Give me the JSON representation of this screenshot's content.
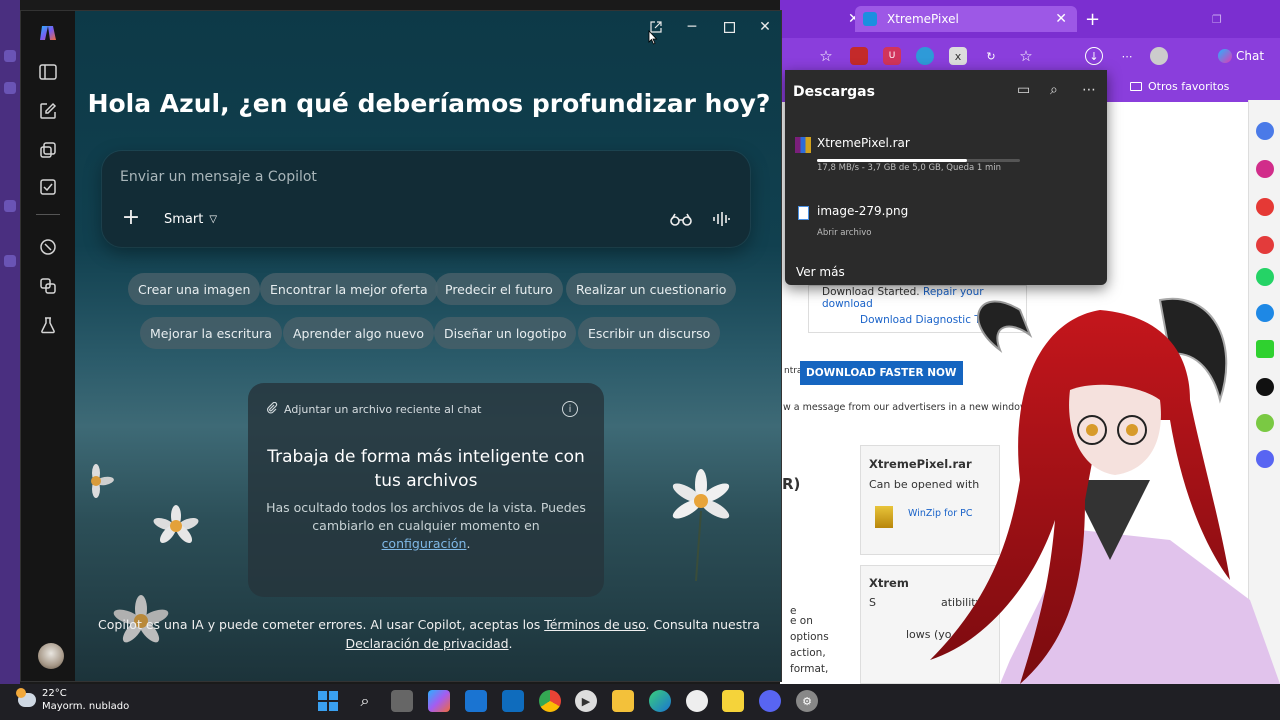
{
  "copilot": {
    "greeting": "Hola Azul, ¿en qué deberíamos profundizar hoy?",
    "composer": {
      "placeholder": "Enviar un mensaje a Copilot",
      "mode_label": "Smart"
    },
    "chips_row1": [
      "Crear una imagen",
      "Encontrar la mejor oferta",
      "Predecir el futuro",
      "Realizar un cuestionario"
    ],
    "chips_row2": [
      "Mejorar la escritura",
      "Aprender algo nuevo",
      "Diseñar un logotipo",
      "Escribir un discurso"
    ],
    "file_card": {
      "header": "Adjuntar un archivo reciente al chat",
      "title": "Trabaja de forma más inteligente con tus archivos",
      "body": "Has ocultado todos los archivos de la vista. Puedes cambiarlo en cualquier momento en",
      "link": "configuración",
      "period": "."
    },
    "disclaimer": {
      "part1": "Copilot es una IA y puede cometer errores. Al usar Copilot, aceptas los",
      "terms_link": "Términos de uso",
      "part2": ". Consulta nuestra",
      "privacy_link": "Declaración de privacidad",
      "part3": "."
    }
  },
  "browser": {
    "tab_active": "XtremePixel",
    "chat_label": "Chat",
    "bookmarks_label": "Otros favoritos"
  },
  "downloads": {
    "title": "Descargas",
    "items": [
      {
        "name": "XtremePixel.rar",
        "meta": "17,8 MB/s - 3,7 GB de 5,0 GB, Queda 1 min",
        "progress": 0.74
      },
      {
        "name": "image-279.png",
        "meta": "Abrir archivo"
      }
    ],
    "more": "Ver más"
  },
  "webpage": {
    "download_started": "Download Started.",
    "repair_link": "Repair your download",
    "diagnostic_link": "Download Diagnostic Tool",
    "faster_button": "DOWNLOAD FASTER NOW",
    "ntra_text": "ntra",
    "advert_text": "w a message from our advertisers in a new window",
    "r_text": "R)",
    "card1_title": "XtremePixel.rar",
    "card1_open": "Can be opened with",
    "card1_winzip": "WinZip for PC",
    "card2_title": "Xtrem",
    "card2_text": "atibility",
    "frag_s": "S",
    "frag_1": "e",
    "frag_2": "n",
    "frag_3": "e on",
    "frag_4": "options",
    "frag_5": "action,",
    "frag_6": "format,",
    "frag_7": "lows (yo"
  },
  "taskbar": {
    "temperature": "22°C",
    "weather": "Mayorm. nublado"
  },
  "colors": {
    "accent_purple": "#7b2fd0",
    "link_blue": "#7fb8e6"
  }
}
